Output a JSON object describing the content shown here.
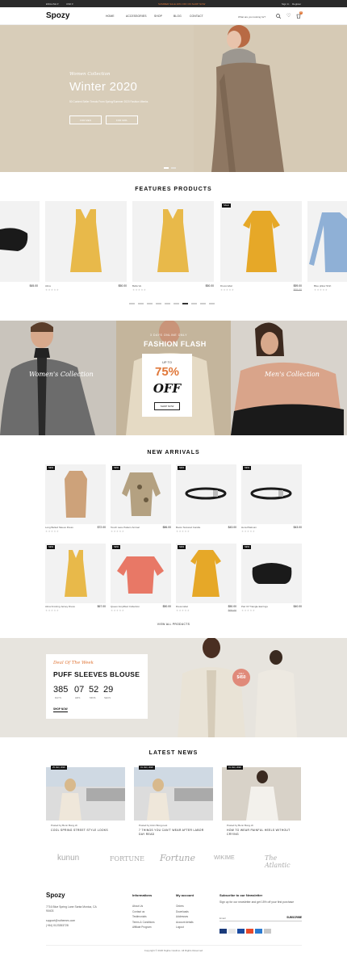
{
  "topbar": {
    "language": "ENGLISH",
    "currency": "USD",
    "promo": "SUMMER SALE 20% OFF ON SHOP NOW",
    "signin": "Sign In",
    "register": "Register"
  },
  "header": {
    "logo": "Spozy",
    "nav": [
      "HOME",
      "ACCESSORIES",
      "SHOP",
      "BLOG",
      "CONTACT"
    ],
    "search_placeholder": "What are you looking for?",
    "cart_count": "0"
  },
  "hero": {
    "kicker": "Women Collection",
    "title": "Winter 2020",
    "subtitle": "50 Content Seller Trends From Spring/Summer 2020 Fashion Weeks",
    "btn1": "FOR MEN",
    "btn2": "FOR GIRL",
    "colors": {
      "bg": "#d8cdb9"
    }
  },
  "features": {
    "title": "FEATURES PRODUCTS",
    "products": [
      {
        "name": "",
        "price": "$45.00",
        "old": ""
      },
      {
        "name": "Alma",
        "price": "$50.00",
        "old": ""
      },
      {
        "name": "Bella Va",
        "price": "$50.00",
        "old": ""
      },
      {
        "name": "Dress label",
        "price": "$59.00",
        "old": "$65.00",
        "badge": "SALE"
      },
      {
        "name": "Blue pillow Shirt",
        "price": "$35.00",
        "old": ""
      }
    ]
  },
  "banner": {
    "left_script": "Women's Collection",
    "right_script": "Men's Collection",
    "top_label": "3 DAYS ONLINE ONLY",
    "headline": "FASHION FLASH",
    "upto": "UP TO",
    "percent": "75%",
    "off": "OFF",
    "cta": "SHOP NOW"
  },
  "arrivals": {
    "title": "NEW ARRIVALS",
    "products": [
      {
        "name": "Long Belted Sleeve Dress",
        "price": "$72.00",
        "old": "",
        "badge": "NEW"
      },
      {
        "name": "Touch Lace Pattern Animal",
        "price": "$86.00",
        "old": "",
        "badge": "NEW"
      },
      {
        "name": "Boots Textured Candle",
        "price": "$43.00",
        "old": "",
        "badge": "NEW"
      },
      {
        "name": "Hora Platinum",
        "price": "$43.00",
        "old": "",
        "badge": "NEW"
      },
      {
        "name": "Alma Frosting Jersey Dress",
        "price": "$67.00",
        "old": "",
        "badge": "NEW"
      },
      {
        "name": "Queen Amplified Collection",
        "price": "$50.00",
        "old": "",
        "badge": "NEW"
      },
      {
        "name": "Dress label",
        "price": "$50.00",
        "old": "$65.00",
        "badge": "NEW"
      },
      {
        "name": "Pair Of Triangle Earrings",
        "price": "$40.00",
        "old": "",
        "badge": "NEW"
      }
    ],
    "view_all": "VIEW ALL PRODUCTS"
  },
  "deal": {
    "kicker": "Deal Of The Week",
    "title": "PUFF SLEEVES BLOUSE",
    "days": "385",
    "hrs": "07",
    "mins": "52",
    "secs": "29",
    "l_days": "DAYS",
    "l_hrs": "HRS",
    "l_mins": "MINS",
    "l_secs": "SECS",
    "cta": "SHOP NOW",
    "badge_small": "ONLY",
    "badge_price": "$450",
    "badge_color": "#e08a7a"
  },
  "news": {
    "title": "LATEST NEWS",
    "items": [
      {
        "date": "25 JAN, 2020",
        "by": "Posted by Bonn Bong.ch",
        "title": "COOL SPRING STREET STYLE LOOKS"
      },
      {
        "date": "01 JAN, 2020",
        "by": "Posted by Anim Bong.nest",
        "title": "7 THINGS YOU CAN'T WEAR AFTER LABOR DAY READ"
      },
      {
        "date": "01 JAN, 2020",
        "by": "Posted by Bonn Bong.ch",
        "title": "HOW TO WEAR PAINFUL HEELS WITHOUT CRYING"
      }
    ]
  },
  "brands": [
    "kunun",
    "FORTUNE",
    "Fortune",
    "WIKIME",
    "The Atlantic"
  ],
  "footer": {
    "logo": "Spozy",
    "address": "7716 Blue Spring Lane Santa Monica, CA 90403",
    "email": "support@ruthemes.com",
    "phone": "(+84) 0123353728",
    "info_title": "Informations",
    "info_links": [
      "About Us",
      "Contact us",
      "Testimonials",
      "Terms & Conditions",
      "Affiliate Program"
    ],
    "acc_title": "My account",
    "acc_links": [
      "Orders",
      "Downloads",
      "Addresses",
      "Account details",
      "Logout"
    ],
    "news_title": "Subscribe to our Newsletter",
    "news_text": "Sign up for our newsletter and get 15% off your first purchase",
    "news_placeholder": "Email",
    "subscribe": "SUBSCRIBE",
    "copyright": "Copyright © 2020 Nighte Caslimo. All Rights Reserved"
  }
}
